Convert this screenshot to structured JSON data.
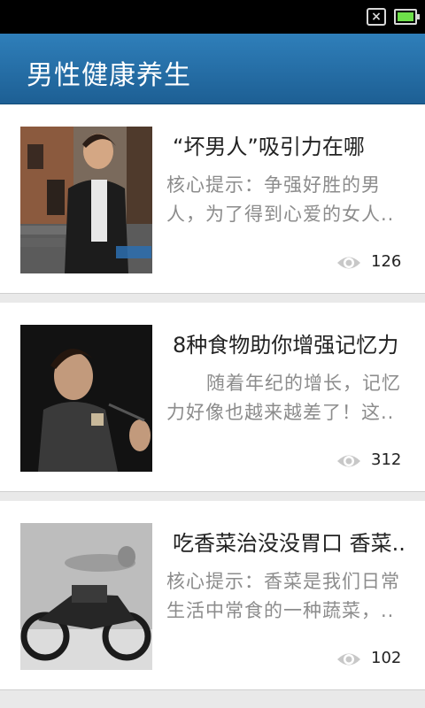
{
  "statusbar": {
    "icons": [
      "no-sim-icon",
      "battery-icon"
    ],
    "battery_color": "#6ee04a"
  },
  "header": {
    "title": "男性健康养生",
    "color": "#2f7fba"
  },
  "articles": [
    {
      "title": "“坏男人”吸引力在哪",
      "summary": "核心提示：争强好胜的男人，为了得到心爱的女人..",
      "views": "126"
    },
    {
      "title": "8种食物助你增强记忆力",
      "summary": "随着年纪的增长，记忆力好像也越来越差了！这..",
      "views": "312"
    },
    {
      "title": "吃香菜治没没胃口 香菜..",
      "summary": "核心提示：香菜是我们日常生活中常食的一种蔬菜，..",
      "views": "102"
    }
  ]
}
